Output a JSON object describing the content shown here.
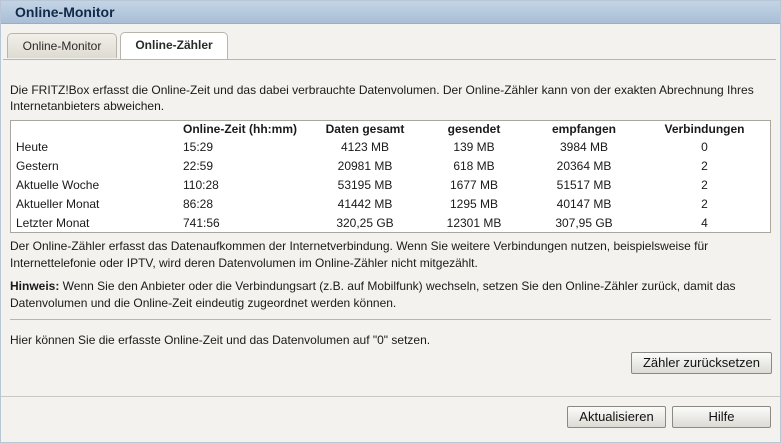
{
  "window": {
    "title": "Online-Monitor"
  },
  "tabs": [
    {
      "label": "Online-Monitor"
    },
    {
      "label": "Online-Zähler"
    }
  ],
  "intro": "Die FRITZ!Box erfasst die Online-Zeit und das dabei verbrauchte Datenvolumen. Der Online-Zähler kann von der exakten Abrechnung Ihres Internetanbieters abweichen.",
  "table": {
    "headers": [
      "",
      "Online-Zeit (hh:mm)",
      "Daten gesamt",
      "gesendet",
      "empfangen",
      "Verbindungen"
    ],
    "rows": [
      [
        "Heute",
        "15:29",
        "4123 MB",
        "139 MB",
        "3984 MB",
        "0"
      ],
      [
        "Gestern",
        "22:59",
        "20981 MB",
        "618 MB",
        "20364 MB",
        "2"
      ],
      [
        "Aktuelle Woche",
        "110:28",
        "53195 MB",
        "1677 MB",
        "51517 MB",
        "2"
      ],
      [
        "Aktueller Monat",
        "86:28",
        "41442 MB",
        "1295 MB",
        "40147 MB",
        "2"
      ],
      [
        "Letzter Monat",
        "741:56",
        "320,25 GB",
        "12301 MB",
        "307,95 GB",
        "4"
      ]
    ]
  },
  "note1": "Der Online-Zähler erfasst das Datenaufkommen der Internetverbindung. Wenn Sie weitere Verbindungen nutzen, beispielsweise für Internettelefonie oder IPTV, wird deren Datenvolumen im Online-Zähler nicht mitgezählt.",
  "note2": {
    "label": "Hinweis:",
    "text": " Wenn Sie den Anbieter oder die Verbindungsart (z.B. auf Mobilfunk) wechseln, setzen Sie den Online-Zähler zurück, damit das Datenvolumen und die Online-Zeit eindeutig zugeordnet werden können."
  },
  "reset_text": "Hier können Sie die erfasste Online-Zeit und das Datenvolumen auf \"0\" setzen.",
  "buttons": {
    "reset": "Zähler zurücksetzen",
    "refresh": "Aktualisieren",
    "help": "Hilfe"
  }
}
